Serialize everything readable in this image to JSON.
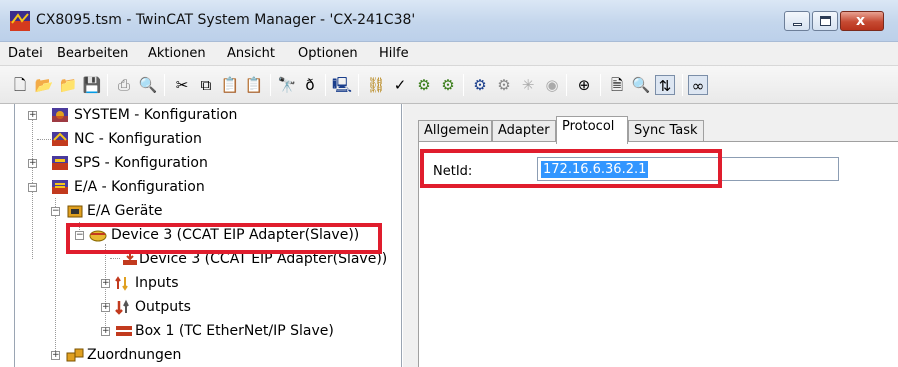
{
  "window": {
    "title": "CX8095.tsm - TwinCAT System Manager - 'CX-241C38'",
    "app_icon": "twincat-app-icon",
    "controls": {
      "minimize_icon": "minimize-icon",
      "maximize_icon": "maximize-icon",
      "close_glyph": "x"
    }
  },
  "menu": [
    "Datei",
    "Bearbeiten",
    "Aktionen",
    "Ansicht",
    "Optionen",
    "Hilfe"
  ],
  "toolbar": {
    "icons": [
      "new-file-icon",
      "open-folder-icon",
      "open-remote-icon",
      "save-icon",
      "print-icon",
      "print-preview-icon",
      "cut-icon",
      "copy-icon",
      "paste-icon",
      "paste-with-links-icon",
      "find-icon",
      "find-next-icon",
      "target-system-icon",
      "generate-mappings-icon",
      "check-configuration-icon",
      "activate-configuration-icon",
      "restart-run-mode-icon",
      "restart-config-mode-icon",
      "reload-devices-icon",
      "scan-devices-icon",
      "toggle-freerun-icon",
      "add-device-icon",
      "scope-icon",
      "zoom-icon",
      "show-online-data-icon",
      "show-sub-items-icon"
    ]
  },
  "tree": {
    "items": [
      {
        "label": "SYSTEM - Konfiguration",
        "icon": "system-config-icon",
        "expander": "+"
      },
      {
        "label": "NC - Konfiguration",
        "icon": "nc-config-icon",
        "expander": ""
      },
      {
        "label": "SPS - Konfiguration",
        "icon": "plc-config-icon",
        "expander": "+"
      },
      {
        "label": "E/A - Konfiguration",
        "icon": "io-config-icon",
        "expander": "−"
      },
      {
        "label": "E/A Geräte",
        "icon": "io-devices-icon",
        "expander": "−"
      },
      {
        "label": "Device 3 (CCAT EIP Adapter(Slave))",
        "icon": "ethernet-device-icon",
        "expander": "−",
        "highlighted": true
      },
      {
        "label": "Device 3 (CCAT EIP Adapter(Slave))",
        "icon": "process-image-icon",
        "expander": ""
      },
      {
        "label": "Inputs",
        "icon": "inputs-icon",
        "expander": "+"
      },
      {
        "label": "Outputs",
        "icon": "outputs-icon",
        "expander": "+"
      },
      {
        "label": "Box 1 (TC EtherNet/IP Slave)",
        "icon": "beckhoff-box-icon",
        "expander": "+"
      },
      {
        "label": "Zuordnungen",
        "icon": "mappings-icon",
        "expander": "+"
      }
    ]
  },
  "tabs": [
    {
      "label": "Allgemein",
      "active": false
    },
    {
      "label": "Adapter",
      "active": false
    },
    {
      "label": "Protocol",
      "active": true
    },
    {
      "label": "Sync Task",
      "active": false
    }
  ],
  "protocol": {
    "netid_label": "NetId:",
    "netid_value": "172.16.6.36.2.1",
    "highlighted": true
  },
  "colors": {
    "highlight_red": "#e01d2d",
    "selection_blue": "#3296ff",
    "titlebar": "#c4d6ec"
  }
}
